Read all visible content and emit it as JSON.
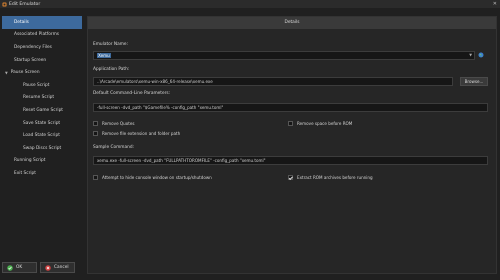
{
  "window": {
    "title": "Edit Emulator",
    "close_glyph": "✕"
  },
  "sidebar": {
    "items": [
      {
        "label": "Details"
      },
      {
        "label": "Associated Platforms"
      },
      {
        "label": "Dependency Files"
      },
      {
        "label": "Startup Screen"
      },
      {
        "label": "Pause Screen"
      },
      {
        "label": "Pause Script"
      },
      {
        "label": "Resume Script"
      },
      {
        "label": "Reset Game Script"
      },
      {
        "label": "Save State Script"
      },
      {
        "label": "Load State Script"
      },
      {
        "label": "Swap Discs Script"
      },
      {
        "label": "Running Script"
      },
      {
        "label": "Exit Script"
      }
    ],
    "selected": "Details",
    "expanded_group": "Pause Screen"
  },
  "main": {
    "header": "Details",
    "emulator_name_label": "Emulator Name:",
    "emulator_name_value": "Xemu",
    "application_path_label": "Application Path:",
    "application_path_value": "..\\Arcade\\emulators\\xemu-win-x86_64-release\\xemu.exe",
    "browse_label": "Browse...",
    "default_cmdline_label": "Default Command-Line Parameters:",
    "default_cmdline_value": "-full-screen -dvd_path \"$Gamefile% -config_path \"xemu.toml\"",
    "remove_quotes_label": "Remove Quotes",
    "remove_quotes_checked": false,
    "remove_space_label": "Remove space before ROM",
    "remove_space_checked": false,
    "remove_ext_label": "Remove file extension and folder path",
    "remove_ext_checked": false,
    "sample_command_label": "Sample Command:",
    "sample_command_value": "xemu.exe -full-screen -dvd_path \"FULLPATHTOROMFILE\" -config_path \"xemu.toml\"",
    "hide_console_label": "Attempt to hide console window on startup/shutdown",
    "hide_console_checked": false,
    "extract_rom_label": "Extract ROM archives before running",
    "extract_rom_checked": true
  },
  "footer": {
    "ok_label": "OK",
    "cancel_label": "Cancel"
  },
  "colors": {
    "accent": "#3d6a9d",
    "background": "#202020",
    "panel": "#262626",
    "field": "#161616",
    "ok_icon": "#4caf50",
    "cancel_icon": "#d04040"
  },
  "icons": {
    "app": "launchbox-icon",
    "globe": "globe-icon",
    "ok": "check-icon",
    "cancel": "cancel-icon"
  }
}
